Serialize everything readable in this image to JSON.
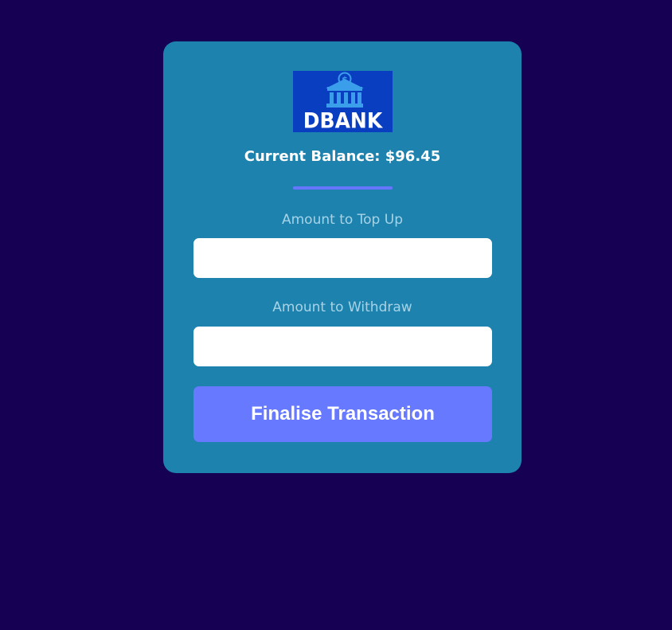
{
  "logo": {
    "icon": "bank-dollar-icon",
    "text": "DBANK",
    "background_color": "#0a3ec0"
  },
  "balance": {
    "text": "Current Balance: $96.45"
  },
  "form": {
    "topup_label": "Amount to Top Up",
    "topup_value": "",
    "withdraw_label": "Amount to Withdraw",
    "withdraw_value": "",
    "submit_label": "Finalise Transaction"
  },
  "colors": {
    "page_background": "#150054",
    "card_background": "#1d82ad",
    "accent": "#6679ff",
    "label_text": "#a6d3e7"
  }
}
